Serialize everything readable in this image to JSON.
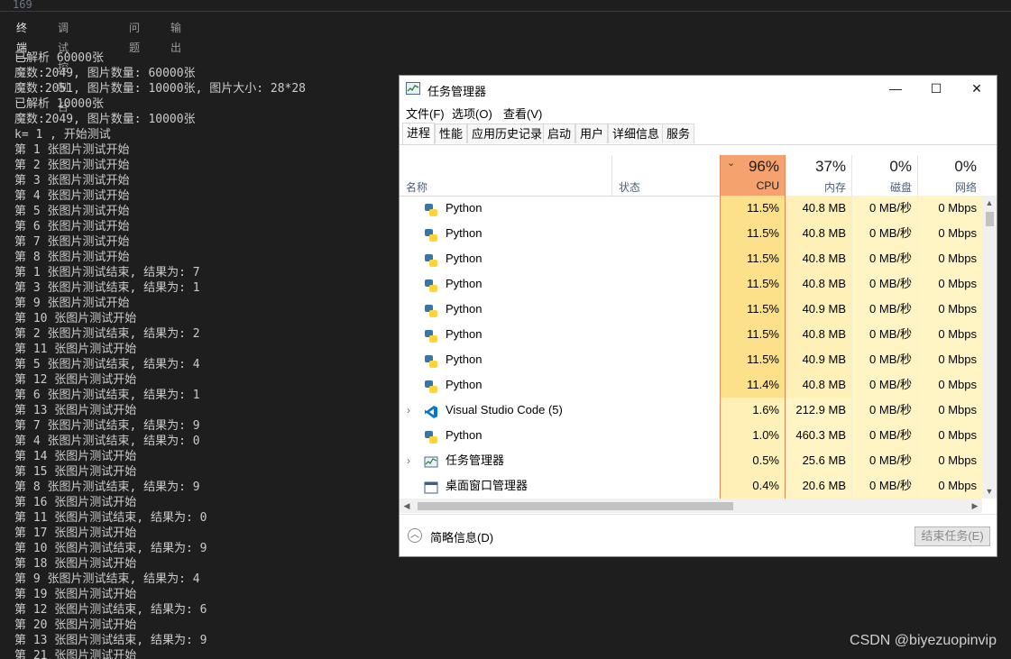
{
  "editor": {
    "line_number": "169"
  },
  "panel": {
    "tabs": [
      {
        "label": "终端",
        "active": true
      },
      {
        "label": "调试控制台",
        "active": false
      },
      {
        "label": "问题",
        "active": false
      },
      {
        "label": "输出",
        "active": false
      }
    ]
  },
  "terminal": {
    "lines": [
      "已解析 60000张",
      "魔数:2049, 图片数量: 60000张",
      "魔数:2051, 图片数量: 10000张, 图片大小: 28*28",
      "已解析 10000张",
      "魔数:2049, 图片数量: 10000张",
      "k= 1 , 开始测试",
      "第 1 张图片测试开始",
      "第 2 张图片测试开始",
      "第 3 张图片测试开始",
      "第 4 张图片测试开始",
      "第 5 张图片测试开始",
      "第 6 张图片测试开始",
      "第 7 张图片测试开始",
      "第 8 张图片测试开始",
      "第 1 张图片测试结束, 结果为: 7",
      "第 3 张图片测试结束, 结果为: 1",
      "第 9 张图片测试开始",
      "第 10 张图片测试开始",
      "第 2 张图片测试结束, 结果为: 2",
      "第 11 张图片测试开始",
      "第 5 张图片测试结束, 结果为: 4",
      "第 12 张图片测试开始",
      "第 6 张图片测试结束, 结果为: 1",
      "第 13 张图片测试开始",
      "第 7 张图片测试结束, 结果为: 9",
      "第 4 张图片测试结束, 结果为: 0",
      "第 14 张图片测试开始",
      "第 15 张图片测试开始",
      "第 8 张图片测试结束, 结果为: 9",
      "第 16 张图片测试开始",
      "第 11 张图片测试结束, 结果为: 0",
      "第 17 张图片测试开始",
      "第 10 张图片测试结束, 结果为: 9",
      "第 18 张图片测试开始",
      "第 9 张图片测试结束, 结果为: 4",
      "第 19 张图片测试开始",
      "第 12 张图片测试结束, 结果为: 6",
      "第 20 张图片测试开始",
      "第 13 张图片测试结束, 结果为: 9",
      "第 21 张图片测试开始"
    ]
  },
  "watermark": "CSDN @biyezuopinvip",
  "task_manager": {
    "title": "任务管理器",
    "window_controls": {
      "minimize": "—",
      "maximize": "☐",
      "close": "✕"
    },
    "menu": [
      "文件(F)",
      "选项(O)",
      "查看(V)"
    ],
    "tabs": [
      {
        "label": "进程",
        "active": true
      },
      {
        "label": "性能",
        "active": false
      },
      {
        "label": "应用历史记录",
        "active": false
      },
      {
        "label": "启动",
        "active": false
      },
      {
        "label": "用户",
        "active": false
      },
      {
        "label": "详细信息",
        "active": false
      },
      {
        "label": "服务",
        "active": false
      }
    ],
    "columns": {
      "name": "名称",
      "status": "状态",
      "cpu": {
        "percent": "96%",
        "label": "CPU"
      },
      "memory": {
        "percent": "37%",
        "label": "内存"
      },
      "disk": {
        "percent": "0%",
        "label": "磁盘"
      },
      "network": {
        "percent": "0%",
        "label": "网络"
      }
    },
    "processes": [
      {
        "name": "Python",
        "icon": "python-icon",
        "expandable": false,
        "cpu": "11.5%",
        "memory": "40.8 MB",
        "disk": "0 MB/秒",
        "network": "0 Mbps"
      },
      {
        "name": "Python",
        "icon": "python-icon",
        "expandable": false,
        "cpu": "11.5%",
        "memory": "40.8 MB",
        "disk": "0 MB/秒",
        "network": "0 Mbps"
      },
      {
        "name": "Python",
        "icon": "python-icon",
        "expandable": false,
        "cpu": "11.5%",
        "memory": "40.8 MB",
        "disk": "0 MB/秒",
        "network": "0 Mbps"
      },
      {
        "name": "Python",
        "icon": "python-icon",
        "expandable": false,
        "cpu": "11.5%",
        "memory": "40.8 MB",
        "disk": "0 MB/秒",
        "network": "0 Mbps"
      },
      {
        "name": "Python",
        "icon": "python-icon",
        "expandable": false,
        "cpu": "11.5%",
        "memory": "40.9 MB",
        "disk": "0 MB/秒",
        "network": "0 Mbps"
      },
      {
        "name": "Python",
        "icon": "python-icon",
        "expandable": false,
        "cpu": "11.5%",
        "memory": "40.8 MB",
        "disk": "0 MB/秒",
        "network": "0 Mbps"
      },
      {
        "name": "Python",
        "icon": "python-icon",
        "expandable": false,
        "cpu": "11.5%",
        "memory": "40.9 MB",
        "disk": "0 MB/秒",
        "network": "0 Mbps"
      },
      {
        "name": "Python",
        "icon": "python-icon",
        "expandable": false,
        "cpu": "11.4%",
        "memory": "40.8 MB",
        "disk": "0 MB/秒",
        "network": "0 Mbps"
      },
      {
        "name": "Visual Studio Code (5)",
        "icon": "vscode-icon",
        "expandable": true,
        "cpu": "1.6%",
        "memory": "212.9 MB",
        "disk": "0 MB/秒",
        "network": "0 Mbps"
      },
      {
        "name": "Python",
        "icon": "python-icon",
        "expandable": false,
        "cpu": "1.0%",
        "memory": "460.3 MB",
        "disk": "0 MB/秒",
        "network": "0 Mbps"
      },
      {
        "name": "任务管理器",
        "icon": "task-manager-icon",
        "expandable": true,
        "cpu": "0.5%",
        "memory": "25.6 MB",
        "disk": "0 MB/秒",
        "network": "0 Mbps"
      },
      {
        "name": "桌面窗口管理器",
        "icon": "window-manager-icon",
        "expandable": false,
        "cpu": "0.4%",
        "memory": "20.6 MB",
        "disk": "0 MB/秒",
        "network": "0 Mbps"
      }
    ],
    "footer": {
      "fewer_details": "简略信息(D)",
      "end_task": "结束任务(E)"
    }
  }
}
